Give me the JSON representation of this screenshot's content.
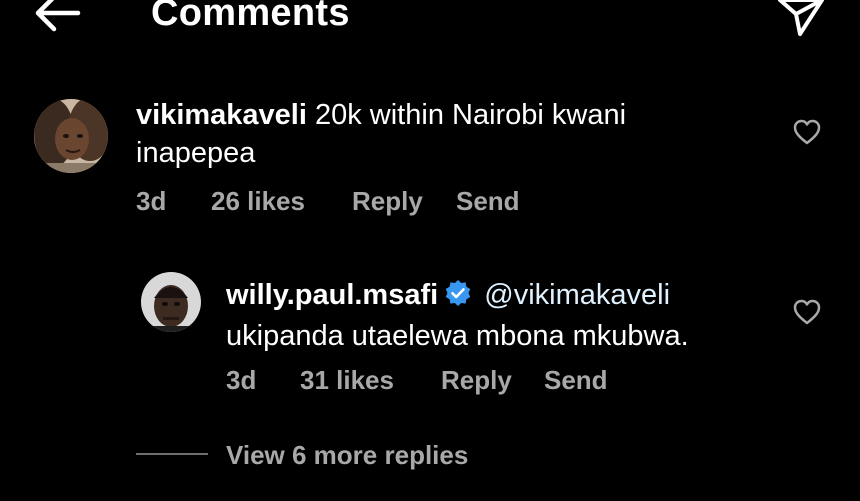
{
  "header": {
    "title": "Comments",
    "back_icon": "arrow-left-icon",
    "share_icon": "paper-plane-icon"
  },
  "comments": [
    {
      "username": "vikimakaveli",
      "text": "20k within Nairobi kwani inapepea",
      "time": "3d",
      "likes": "26 likes",
      "reply_label": "Reply",
      "send_label": "Send"
    }
  ],
  "reply": {
    "username": "willy.paul.msafi",
    "verified": true,
    "mention": "@vikimakaveli",
    "text": "ukipanda utaelewa mbona mkubwa.",
    "time": "3d",
    "likes": "31 likes",
    "reply_label": "Reply",
    "send_label": "Send"
  },
  "view_more": "View 6 more replies",
  "colors": {
    "background": "#000000",
    "text": "#ffffff",
    "secondary": "#a8a8a8",
    "verified_blue": "#3897f0"
  }
}
